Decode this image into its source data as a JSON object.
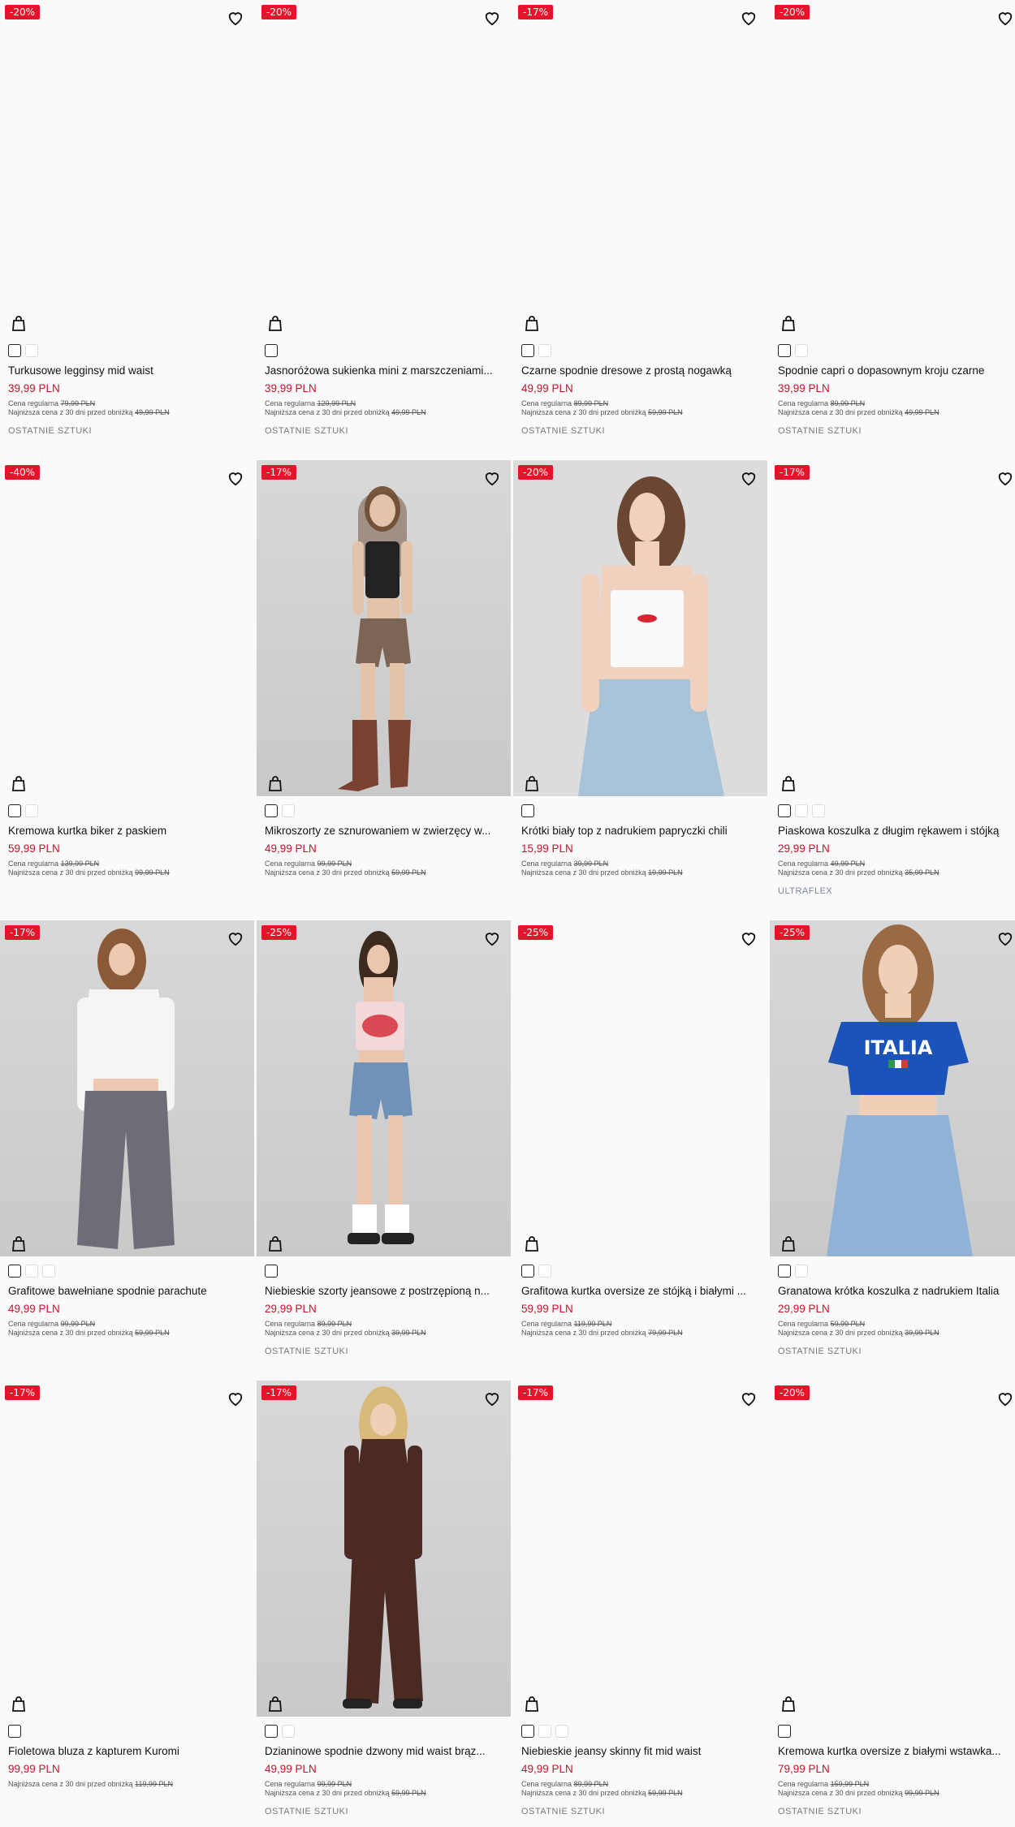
{
  "labels": {
    "regular": "Cena regularna",
    "lowest": "Najniższa cena z 30 dni przed obniżką"
  },
  "products": [
    {
      "name": "Turkusowe legginsy mid waist",
      "discount": "-20%",
      "price": "39,99 PLN",
      "regular_price": "79,99 PLN",
      "lowest_price": "49,99 PLN",
      "tag": "OSTATNIE SZTUKI",
      "swatches": 2,
      "photo": false
    },
    {
      "name": "Jasnoróżowa sukienka mini z marszczeniami...",
      "discount": "-20%",
      "price": "39,99 PLN",
      "regular_price": "129,99 PLN",
      "lowest_price": "49,99 PLN",
      "tag": "OSTATNIE SZTUKI",
      "swatches": 1,
      "photo": false
    },
    {
      "name": "Czarne spodnie dresowe z prostą nogawką",
      "discount": "-17%",
      "price": "49,99 PLN",
      "regular_price": "89,99 PLN",
      "lowest_price": "59,99 PLN",
      "tag": "OSTATNIE SZTUKI",
      "swatches": 2,
      "photo": false
    },
    {
      "name": "Spodnie capri o dopasownym kroju czarne",
      "discount": "-20%",
      "price": "39,99 PLN",
      "regular_price": "89,99 PLN",
      "lowest_price": "49,99 PLN",
      "tag": "OSTATNIE SZTUKI",
      "swatches": 2,
      "photo": false
    },
    {
      "name": "Kremowa kurtka biker z paskiem",
      "discount": "-40%",
      "price": "59,99 PLN",
      "regular_price": "139,99 PLN",
      "lowest_price": "99,99 PLN",
      "tag": "",
      "swatches": 2,
      "photo": false
    },
    {
      "name": "Mikroszorty ze sznurowaniem w zwierzęcy w...",
      "discount": "-17%",
      "price": "49,99 PLN",
      "regular_price": "99,99 PLN",
      "lowest_price": "59,99 PLN",
      "tag": "",
      "swatches": 2,
      "photo": true,
      "figure": "shorts"
    },
    {
      "name": "Krótki biały top z nadrukiem papryczki chili",
      "discount": "-20%",
      "price": "15,99 PLN",
      "regular_price": "39,99 PLN",
      "lowest_price": "19,99 PLN",
      "tag": "",
      "swatches": 1,
      "photo": true,
      "figure": "whitetop"
    },
    {
      "name": "Piaskowa koszulka z długim rękawem i stójką",
      "discount": "-17%",
      "price": "29,99 PLN",
      "regular_price": "49,99 PLN",
      "lowest_price": "35,99 PLN",
      "tag": "ULTRAFLEX",
      "tag_style": "blue",
      "swatches": 3,
      "photo": false
    },
    {
      "name": "Grafitowe bawełniane spodnie parachute",
      "discount": "-17%",
      "price": "49,99 PLN",
      "regular_price": "99,99 PLN",
      "lowest_price": "59,99 PLN",
      "tag": "",
      "swatches": 3,
      "photo": true,
      "figure": "parachute"
    },
    {
      "name": "Niebieskie szorty jeansowe z postrzępioną n...",
      "discount": "-25%",
      "price": "29,99 PLN",
      "regular_price": "89,99 PLN",
      "lowest_price": "39,99 PLN",
      "tag": "OSTATNIE SZTUKI",
      "swatches": 1,
      "photo": true,
      "figure": "jeansshorts"
    },
    {
      "name": "Grafitowa kurtka oversize ze stójką i białymi ...",
      "discount": "-25%",
      "price": "59,99 PLN",
      "regular_price": "119,99 PLN",
      "lowest_price": "79,99 PLN",
      "tag": "",
      "swatches": 2,
      "photo": false
    },
    {
      "name": "Granatowa krótka koszulka z nadrukiem Italia",
      "discount": "-25%",
      "price": "29,99 PLN",
      "regular_price": "59,99 PLN",
      "lowest_price": "39,99 PLN",
      "tag": "OSTATNIE SZTUKI",
      "swatches": 2,
      "photo": true,
      "figure": "italia",
      "print_text": "ITALIA"
    },
    {
      "name": "Fioletowa bluza z kapturem Kuromi",
      "discount": "-17%",
      "price": "99,99 PLN",
      "regular_price": "",
      "lowest_price": "119,99 PLN",
      "tag": "",
      "swatches": 1,
      "photo": false
    },
    {
      "name": "Dzianinowe spodnie dzwony mid waist brąz...",
      "discount": "-17%",
      "price": "49,99 PLN",
      "regular_price": "99,99 PLN",
      "lowest_price": "59,99 PLN",
      "tag": "OSTATNIE SZTUKI",
      "swatches": 2,
      "photo": true,
      "figure": "brown"
    },
    {
      "name": "Niebieskie jeansy skinny fit mid waist",
      "discount": "-17%",
      "price": "49,99 PLN",
      "regular_price": "89,99 PLN",
      "lowest_price": "59,99 PLN",
      "tag": "OSTATNIE SZTUKI",
      "swatches": 3,
      "photo": false
    },
    {
      "name": "Kremowa kurtka oversize z białymi wstawka...",
      "discount": "-20%",
      "price": "79,99 PLN",
      "regular_price": "159,99 PLN",
      "lowest_price": "99,99 PLN",
      "tag": "OSTATNIE SZTUKI",
      "swatches": 1,
      "photo": false
    }
  ],
  "icons": {
    "heart": "heart-icon",
    "bag": "shopping-bag-icon"
  },
  "colors": {
    "badge": "#e4152a",
    "price": "#c8112a"
  }
}
